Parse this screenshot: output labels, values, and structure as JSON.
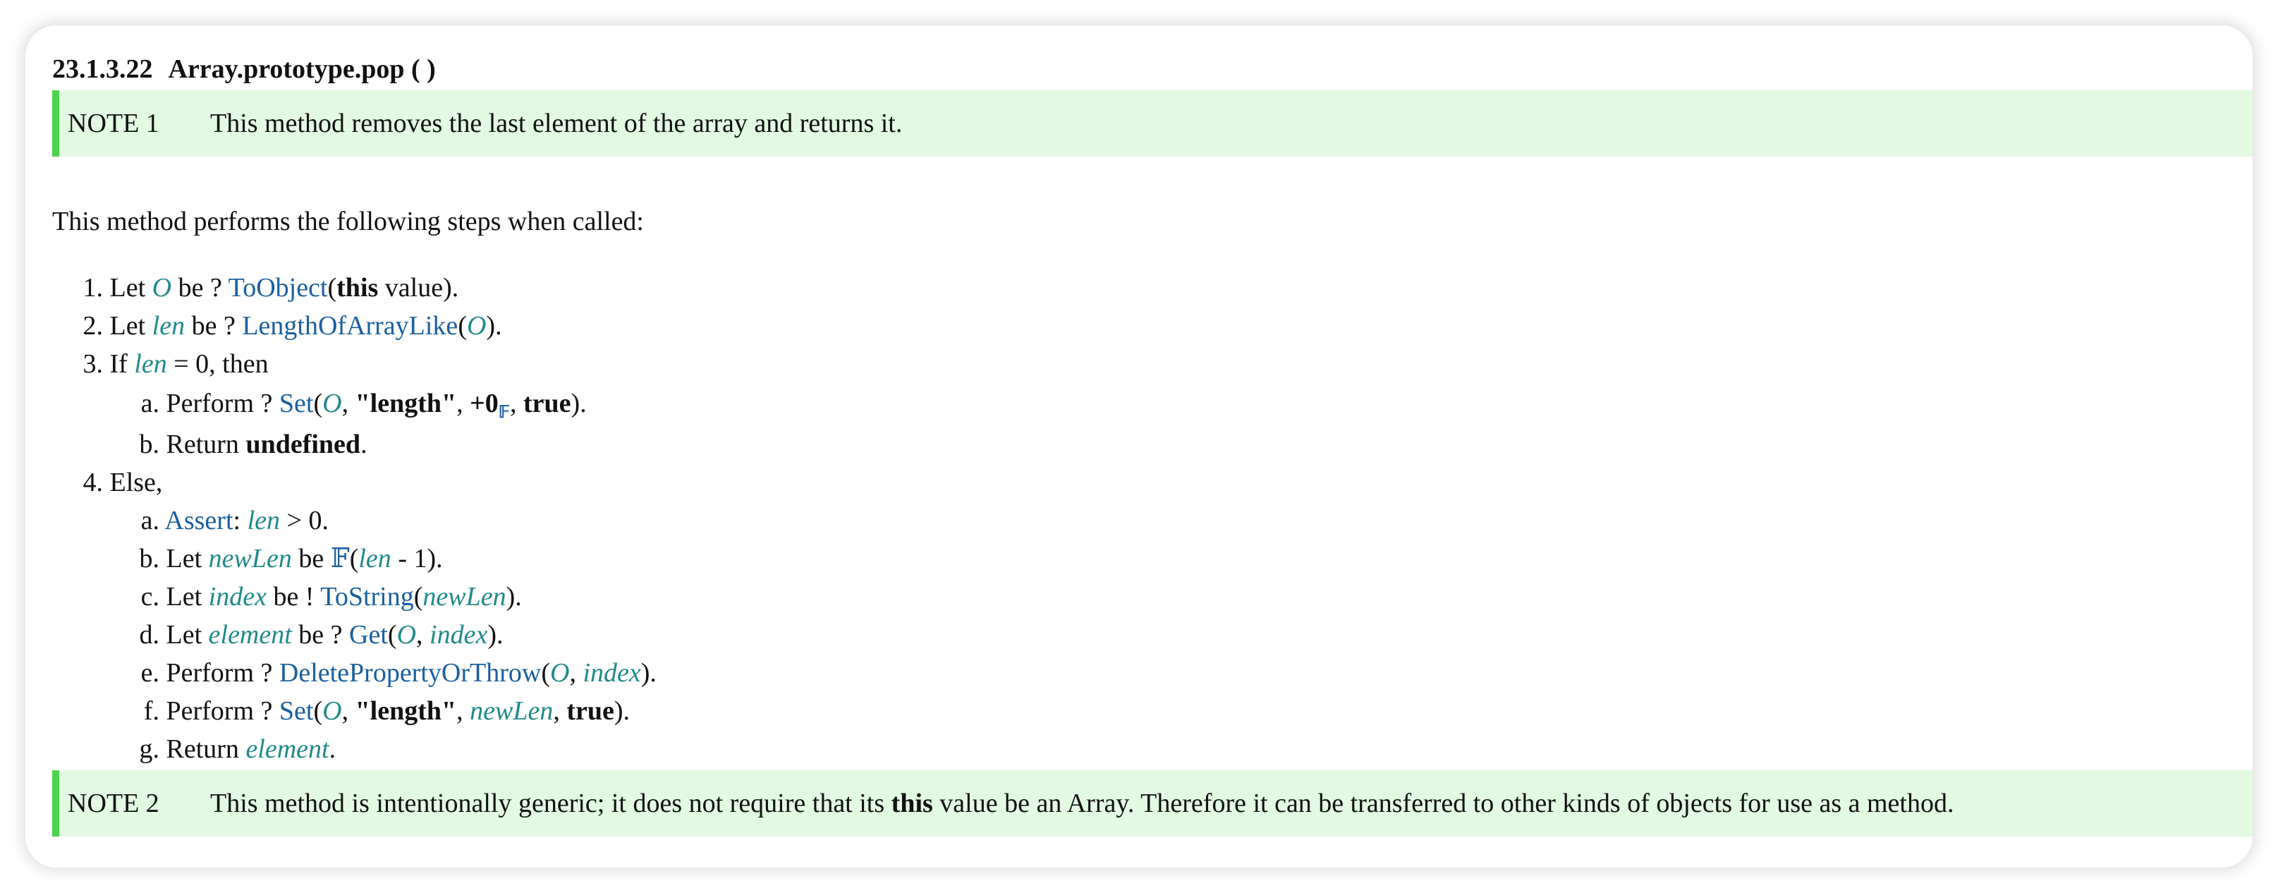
{
  "heading": {
    "number": "23.1.3.22",
    "title": "Array.prototype.pop ( )"
  },
  "note1": {
    "label": "NOTE 1",
    "text": "This method removes the last element of the array and returns it."
  },
  "intro": "This method performs the following steps when called:",
  "steps": {
    "s1": {
      "marker": "1.",
      "t1": "Let ",
      "v1": "O",
      "t2": " be ? ",
      "l1": "ToObject",
      "t3": "(",
      "b1": "this",
      "t4": " value)."
    },
    "s2": {
      "marker": "2.",
      "t1": "Let ",
      "v1": "len",
      "t2": " be ? ",
      "l1": "LengthOfArrayLike",
      "t3": "(",
      "v2": "O",
      "t4": ")."
    },
    "s3": {
      "marker": "3.",
      "t1": "If ",
      "v1": "len",
      "t2": " = 0, then"
    },
    "s3a": {
      "marker": "a.",
      "t1": "Perform ? ",
      "l1": "Set",
      "t2": "(",
      "v1": "O",
      "t3": ", ",
      "b1": "\"length\"",
      "t4": ", ",
      "b2": "+0",
      "sub": "𝔽",
      "t5": ", ",
      "b3": "true",
      "t6": ")."
    },
    "s3b": {
      "marker": "b.",
      "t1": "Return ",
      "b1": "undefined",
      "t2": "."
    },
    "s4": {
      "marker": "4.",
      "t1": "Else,"
    },
    "s4a": {
      "marker": "a.",
      "l1": "Assert",
      "t1": ": ",
      "v1": "len",
      "t2": " > 0."
    },
    "s4b": {
      "marker": "b.",
      "t1": "Let ",
      "v1": "newLen",
      "t2": " be ",
      "l1": "𝔽",
      "t3": "(",
      "v2": "len",
      "t4": " - 1)."
    },
    "s4c": {
      "marker": "c.",
      "t1": "Let ",
      "v1": "index",
      "t2": " be ! ",
      "l1": "ToString",
      "t3": "(",
      "v2": "newLen",
      "t4": ")."
    },
    "s4d": {
      "marker": "d.",
      "t1": "Let ",
      "v1": "element",
      "t2": " be ? ",
      "l1": "Get",
      "t3": "(",
      "v2": "O",
      "t4": ", ",
      "v3": "index",
      "t5": ")."
    },
    "s4e": {
      "marker": "e.",
      "t1": "Perform ? ",
      "l1": "DeletePropertyOrThrow",
      "t2": "(",
      "v1": "O",
      "t3": ", ",
      "v2": "index",
      "t4": ")."
    },
    "s4f": {
      "marker": "f.",
      "t1": "Perform ? ",
      "l1": "Set",
      "t2": "(",
      "v1": "O",
      "t3": ", ",
      "b1": "\"length\"",
      "t4": ", ",
      "v2": "newLen",
      "t5": ", ",
      "b2": "true",
      "t6": ")."
    },
    "s4g": {
      "marker": "g.",
      "t1": "Return ",
      "v1": "element",
      "t2": "."
    }
  },
  "note2": {
    "label": "NOTE 2",
    "t1": "This method is intentionally generic; it does not require that its ",
    "b1": "this",
    "t2": " value be an Array. Therefore it can be transferred to other kinds of objects for use as a method."
  },
  "colors": {
    "note_bg": "#e2f9e2",
    "note_border": "#4cd24c",
    "variable": "#208a8a",
    "link": "#1a5f9f"
  }
}
